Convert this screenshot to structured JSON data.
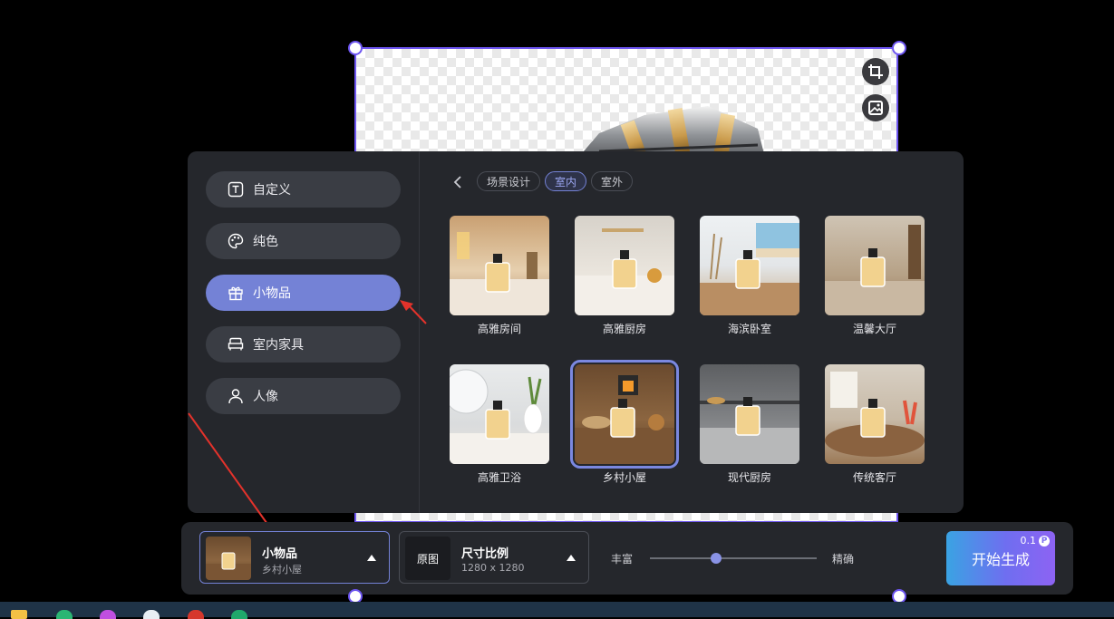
{
  "categories": [
    {
      "label": "自定义",
      "icon": "text-t-icon"
    },
    {
      "label": "纯色",
      "icon": "palette-icon"
    },
    {
      "label": "小物品",
      "icon": "gift-icon",
      "active": true
    },
    {
      "label": "室内家具",
      "icon": "bed-icon"
    },
    {
      "label": "人像",
      "icon": "person-icon"
    }
  ],
  "tabs": [
    {
      "label": "场景设计"
    },
    {
      "label": "室内",
      "active": true
    },
    {
      "label": "室外"
    }
  ],
  "scenes": [
    {
      "label": "高雅房间"
    },
    {
      "label": "高雅厨房"
    },
    {
      "label": "海滨卧室"
    },
    {
      "label": "温馨大厅"
    },
    {
      "label": "高雅卫浴"
    },
    {
      "label": "乡村小屋",
      "selected": true
    },
    {
      "label": "现代厨房"
    },
    {
      "label": "传统客厅"
    }
  ],
  "toolbar": {
    "scene_select": {
      "title": "小物品",
      "subtitle": "乡村小屋"
    },
    "size_select": {
      "thumb_label": "原图",
      "title": "尺寸比例",
      "subtitle": "1280 x 1280"
    },
    "slider": {
      "left_label": "丰富",
      "right_label": "精确",
      "value": 0.4
    },
    "generate": {
      "label": "开始生成",
      "cost": "0.1"
    }
  },
  "colors": {
    "accent": "#7482d6",
    "panel": "#25272c",
    "canvas_border": "#6d55f0"
  }
}
